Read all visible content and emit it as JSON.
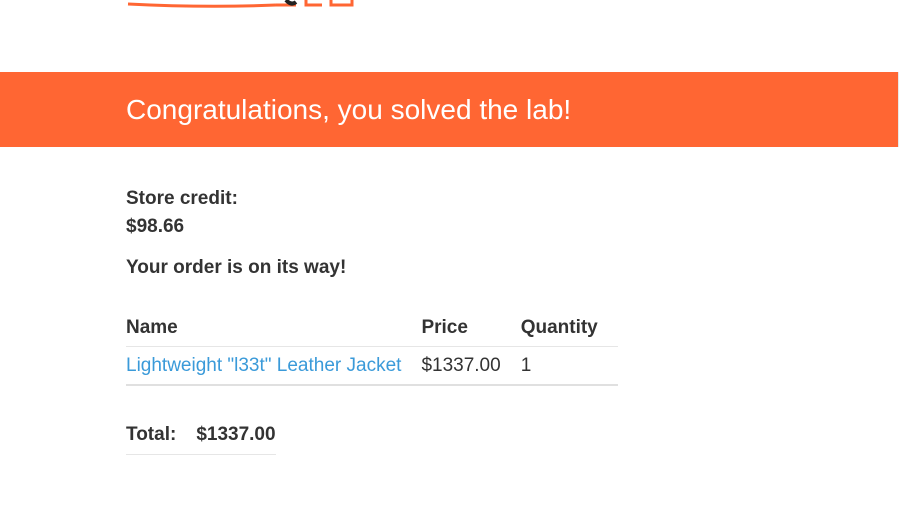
{
  "banner": {
    "message": "Congratulations, you solved the lab!",
    "color": "#ff6633"
  },
  "account": {
    "credit_label": "Store credit:",
    "credit_value": "$98.66"
  },
  "order": {
    "status_message": "Your order is on its way!",
    "columns": [
      "Name",
      "Price",
      "Quantity"
    ],
    "items": [
      {
        "name": "Lightweight \"l33t\" Leather Jacket",
        "price": "$1337.00",
        "quantity": "1"
      }
    ],
    "total_label": "Total:",
    "total_value": "$1337.00"
  },
  "colors": {
    "accent": "#ff6633",
    "link": "#3a9ad9",
    "text": "#333333"
  }
}
